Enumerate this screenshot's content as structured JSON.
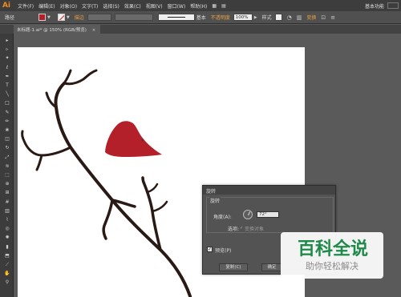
{
  "app": {
    "logo": "Ai"
  },
  "menu": {
    "items": [
      "文件(F)",
      "编辑(E)",
      "对象(O)",
      "文字(T)",
      "选择(S)",
      "效果(C)",
      "视图(V)",
      "窗口(W)",
      "帮助(H)"
    ],
    "workspace": "基本功能"
  },
  "control": {
    "path_label": "路径",
    "stroke_label": "描边",
    "stroke_style": "基本",
    "opacity_label": "不透明度",
    "opacity_value": "100%",
    "style_label": "样式",
    "transform_label": "变换",
    "fill_color": "#b3202a"
  },
  "document": {
    "tab_title": "未标题-1.ai* @ 150% (RGB/预览)"
  },
  "tools": [
    {
      "name": "selection-tool",
      "glyph": "▸"
    },
    {
      "name": "direct-selection-tool",
      "glyph": "▹"
    },
    {
      "name": "magic-wand-tool",
      "glyph": "✦"
    },
    {
      "name": "lasso-tool",
      "glyph": "ℓ"
    },
    {
      "name": "pen-tool",
      "glyph": "✒"
    },
    {
      "name": "type-tool",
      "glyph": "T"
    },
    {
      "name": "line-tool",
      "glyph": "╲"
    },
    {
      "name": "rectangle-tool",
      "glyph": "□"
    },
    {
      "name": "paintbrush-tool",
      "glyph": "✎"
    },
    {
      "name": "pencil-tool",
      "glyph": "✏"
    },
    {
      "name": "blob-brush-tool",
      "glyph": "❀"
    },
    {
      "name": "eraser-tool",
      "glyph": "◫"
    },
    {
      "name": "rotate-tool",
      "glyph": "↻"
    },
    {
      "name": "scale-tool",
      "glyph": "⤢"
    },
    {
      "name": "warp-tool",
      "glyph": "≋"
    },
    {
      "name": "free-transform-tool",
      "glyph": "⬚"
    },
    {
      "name": "shape-builder-tool",
      "glyph": "⊕"
    },
    {
      "name": "perspective-grid-tool",
      "glyph": "⊞"
    },
    {
      "name": "mesh-tool",
      "glyph": "#"
    },
    {
      "name": "gradient-tool",
      "glyph": "▥"
    },
    {
      "name": "eyedropper-tool",
      "glyph": "⌇"
    },
    {
      "name": "blend-tool",
      "glyph": "◎"
    },
    {
      "name": "symbol-sprayer-tool",
      "glyph": "✺"
    },
    {
      "name": "column-graph-tool",
      "glyph": "▮"
    },
    {
      "name": "artboard-tool",
      "glyph": "⬒"
    },
    {
      "name": "slice-tool",
      "glyph": "⟋"
    },
    {
      "name": "hand-tool",
      "glyph": "✋"
    },
    {
      "name": "zoom-tool",
      "glyph": "⚲"
    }
  ],
  "dialog": {
    "title": "旋转",
    "group_title": "旋转",
    "angle_label": "角度(A):",
    "angle_value": "72°",
    "options_label": "选项:",
    "transform_objects": "变换对象",
    "preview_label": "预览(P)",
    "preview_checked": "✓",
    "copy_button": "复制(C)",
    "ok_button": "确定"
  },
  "watermark": {
    "title": "百科全说",
    "tagline": "助你轻松解决"
  },
  "artwork": {
    "branch_color": "#2a1a16",
    "leaf_color": "#b3202a"
  }
}
